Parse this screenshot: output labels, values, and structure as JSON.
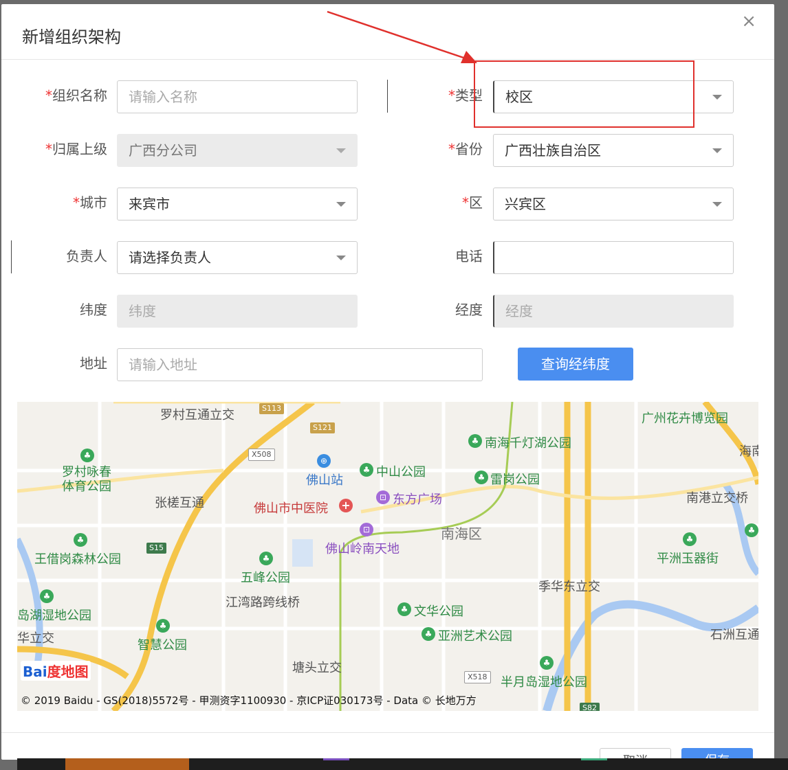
{
  "modal": {
    "title": "新增组织架构",
    "close": "×"
  },
  "form": {
    "org_name": {
      "label": "组织名称",
      "required": "*",
      "placeholder": "请输入名称",
      "value": ""
    },
    "type": {
      "label": "类型",
      "required": "*",
      "value": "校区"
    },
    "parent": {
      "label": "归属上级",
      "required": "*",
      "value": "广西分公司"
    },
    "province": {
      "label": "省份",
      "required": "*",
      "value": "广西壮族自治区"
    },
    "city": {
      "label": "城市",
      "required": "*",
      "value": "来宾市"
    },
    "district": {
      "label": "区",
      "required": "*",
      "value": "兴宾区"
    },
    "manager": {
      "label": "负责人",
      "value": "请选择负责人"
    },
    "phone": {
      "label": "电话",
      "value": ""
    },
    "latitude": {
      "label": "纬度",
      "placeholder": "纬度"
    },
    "longitude": {
      "label": "经度",
      "placeholder": "经度"
    },
    "address": {
      "label": "地址",
      "placeholder": "请输入地址"
    },
    "query_button": "查询经纬度"
  },
  "map": {
    "labels": {
      "luocun": "罗村互通立交",
      "guangzhou_flower": "广州花卉博览园",
      "nanhai_lake": "南海千灯湖公园",
      "haina": "海南",
      "luocun_park": "罗村咏春\n体育公园",
      "foshan_station": "佛山站",
      "zhongshan_park": "中山公园",
      "leigang_park": "雷岗公园",
      "nangang": "南港立交桥",
      "zhangcha": "张槎互通",
      "hospital": "佛山市中医院",
      "dongfang": "东方广场",
      "nanhai_district": "南海区",
      "wangjiegang": "王借岗森林公园",
      "lingnan": "佛山岭南天地",
      "pingzhou": "平洲玉器街",
      "wufeng": "五峰公园",
      "jihua": "季华东立交",
      "jiangwan": "江湾路跨线桥",
      "lake_wetland": "岛湖湿地公园",
      "wenhua": "文华公园",
      "asia_art": "亚洲艺术公园",
      "shizhou": "石洲互通",
      "liqiao": "华立交",
      "zhihui": "智慧公园",
      "tangtou": "塘头立交",
      "banyue": "半月岛湿地公园"
    },
    "badges": {
      "s113": "S113",
      "s121": "S121",
      "x508": "X508",
      "s15": "S15",
      "x518": "X518",
      "s82": "S82"
    },
    "logo_bai": "Bai",
    "logo_du": "度地图",
    "copyright": "© 2019 Baidu - GS(2018)5572号 - 甲测资字1100930 - 京ICP证030173号 - Data © 长地万方"
  },
  "footer": {
    "cancel": "取消",
    "save": "保存"
  }
}
